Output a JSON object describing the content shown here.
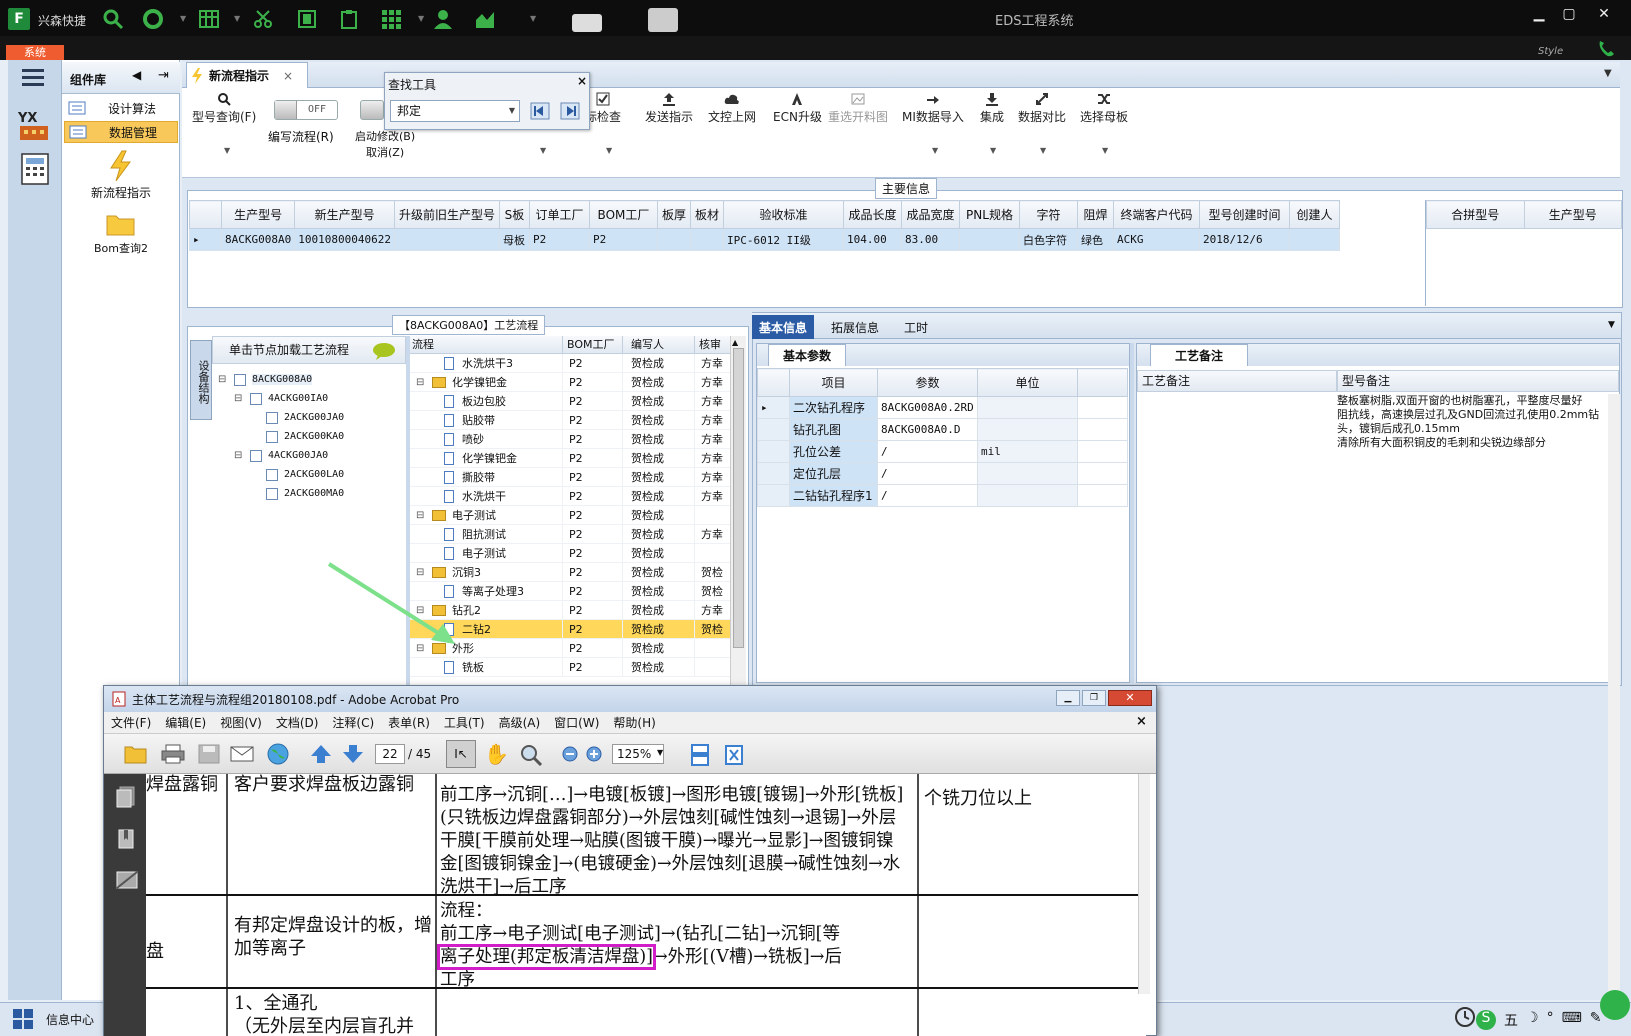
{
  "app": {
    "tag": "兴森快捷",
    "window_title": "EDS工程系统",
    "system_tab": "系统",
    "style_label": "Style"
  },
  "sidebar": {
    "header": "组件库",
    "items": [
      {
        "label": "设计算法"
      },
      {
        "label": "数据管理"
      }
    ],
    "big_items": [
      {
        "label": "新流程指示"
      },
      {
        "label": "Bom查询2"
      }
    ]
  },
  "tabs": [
    {
      "label": "新流程指示"
    }
  ],
  "toolbar": {
    "model_query": "型号查询(F)",
    "edit_flow": "编写流程(R)",
    "toggle_state": "OFF",
    "start_modify": "启动修改(B)",
    "cancel": "取消(Z)",
    "items": [
      {
        "label": "标检查"
      },
      {
        "label": "发送指示"
      },
      {
        "label": "文控上网"
      },
      {
        "label": "ECN升级"
      },
      {
        "label": "重选开料图"
      },
      {
        "label": "MI数据导入"
      },
      {
        "label": "集成"
      },
      {
        "label": "数据对比"
      },
      {
        "label": "选择母板"
      }
    ]
  },
  "find_tool": {
    "title": "查找工具",
    "value": "邦定"
  },
  "main_info": {
    "title": "主要信息",
    "columns": [
      "生产型号",
      "新生产型号",
      "升级前旧生产型号",
      "S板",
      "订单工厂",
      "BOM工厂",
      "板厚",
      "板材",
      "验收标准",
      "成品长度",
      "成品宽度",
      "PNL规格",
      "字符",
      "阻焊",
      "终端客户代码",
      "型号创建时间",
      "创建人"
    ],
    "row": [
      "8ACKG008A0",
      "10010800040622",
      "",
      "母板",
      "P2",
      "P2",
      "",
      "",
      "IPC-6012 II级",
      "104.00",
      "83.00",
      "",
      "白色字符",
      "绿色",
      "ACKG",
      "2018/12/6",
      ""
    ],
    "side_columns": [
      "合拼型号",
      "生产型号"
    ]
  },
  "flow": {
    "title": "【8ACKG008A0】工艺流程",
    "tree_hint": "单击节点加载工艺流程",
    "side_tab": "设备结构",
    "tree": [
      {
        "label": "8ACKG008A0",
        "level": 0
      },
      {
        "label": "4ACKG00IA0",
        "level": 1
      },
      {
        "label": "2ACKG00JA0",
        "level": 2
      },
      {
        "label": "2ACKG00KA0",
        "level": 2
      },
      {
        "label": "4ACKG00JA0",
        "level": 1
      },
      {
        "label": "2ACKG00LA0",
        "level": 2
      },
      {
        "label": "2ACKG00MA0",
        "level": 2
      }
    ],
    "columns": [
      "流程",
      "BOM工厂",
      "编写人",
      "核审"
    ],
    "rows": [
      {
        "name": "水洗烘干3",
        "folder": false,
        "bom": "P2",
        "writer": "贺检成",
        "check": "方幸"
      },
      {
        "name": "化学镍钯金",
        "folder": true,
        "bom": "P2",
        "writer": "贺检成",
        "check": "方幸"
      },
      {
        "name": "板边包胶",
        "folder": false,
        "bom": "P2",
        "writer": "贺检成",
        "check": "方幸"
      },
      {
        "name": "贴胶带",
        "folder": false,
        "bom": "P2",
        "writer": "贺检成",
        "check": "方幸"
      },
      {
        "name": "喷砂",
        "folder": false,
        "bom": "P2",
        "writer": "贺检成",
        "check": "方幸"
      },
      {
        "name": "化学镍钯金",
        "folder": false,
        "bom": "P2",
        "writer": "贺检成",
        "check": "方幸"
      },
      {
        "name": "撕胶带",
        "folder": false,
        "bom": "P2",
        "writer": "贺检成",
        "check": "方幸"
      },
      {
        "name": "水洗烘干",
        "folder": false,
        "bom": "P2",
        "writer": "贺检成",
        "check": "方幸"
      },
      {
        "name": "电子测试",
        "folder": true,
        "bom": "P2",
        "writer": "贺检成",
        "check": ""
      },
      {
        "name": "阻抗测试",
        "folder": false,
        "bom": "P2",
        "writer": "贺检成",
        "check": "方幸"
      },
      {
        "name": "电子测试",
        "folder": false,
        "bom": "P2",
        "writer": "贺检成",
        "check": ""
      },
      {
        "name": "沉铜3",
        "folder": true,
        "bom": "P2",
        "writer": "贺检成",
        "check": "贺检"
      },
      {
        "name": "等离子处理3",
        "folder": false,
        "bom": "P2",
        "writer": "贺检成",
        "check": "贺检"
      },
      {
        "name": "钻孔2",
        "folder": true,
        "bom": "P2",
        "writer": "贺检成",
        "check": "方幸"
      },
      {
        "name": "二钻2",
        "folder": false,
        "bom": "P2",
        "writer": "贺检成",
        "check": "贺检",
        "selected": true
      },
      {
        "name": "外形",
        "folder": true,
        "bom": "P2",
        "writer": "贺检成",
        "check": ""
      },
      {
        "name": "铣板",
        "folder": false,
        "bom": "P2",
        "writer": "贺检成",
        "check": ""
      }
    ]
  },
  "detail": {
    "tabs": [
      "基本信息",
      "拓展信息",
      "工时"
    ],
    "sub_tab": "基本参数",
    "columns": [
      "项目",
      "参数",
      "单位"
    ],
    "rows": [
      {
        "item": "二次钻孔程序",
        "param": "8ACKG008A0.2RD",
        "unit": ""
      },
      {
        "item": "钻孔孔图",
        "param": "8ACKG008A0.D",
        "unit": ""
      },
      {
        "item": "孔位公差",
        "param": "/",
        "unit": "mil"
      },
      {
        "item": "定位孔层",
        "param": "/",
        "unit": ""
      },
      {
        "item": "二钻钻孔程序1",
        "param": "/",
        "unit": ""
      }
    ]
  },
  "remarks": {
    "tab": "工艺备注",
    "col1": "工艺备注",
    "col2": "型号备注",
    "text": [
      "整板塞树脂,双面开窗的也树脂塞孔，平整度尽量好",
      "阻抗线，高速换层过孔及GND回流过孔使用0.2mm钻头，镀铜后成孔0.15mm",
      "清除所有大面积铜皮的毛刺和尖锐边缘部分"
    ]
  },
  "acrobat": {
    "title": "主体工艺流程与流程组20180108.pdf - Adobe Acrobat Pro",
    "menu": [
      "文件(F)",
      "编辑(E)",
      "视图(V)",
      "文档(D)",
      "注释(C)",
      "表单(R)",
      "工具(T)",
      "高级(A)",
      "窗口(W)",
      "帮助(H)"
    ],
    "page": "22",
    "pages": "/ 45",
    "zoom": "125%",
    "doc": {
      "r1c1": "焊盘露铜",
      "r1c2": "客户要求焊盘板边露铜",
      "r1c3": "前工序→沉铜[…]→电镀[板镀]→图形电镀[镀锡]→外形[铣板](只铣板边焊盘露铜部分)→外层蚀刻[碱性蚀刻→退锡]→外层干膜[干膜前处理→贴膜(图镀干膜)→曝光→显影]→图镀铜镍金[图镀铜镍金]→(电镀硬金)→外层蚀刻[退膜→碱性蚀刻→水洗烘干]→后工序",
      "r1c4": "个铣刀位以上",
      "r2c1": "盘",
      "r2c2": "有邦定焊盘设计的板，增加等离子",
      "r2c3a": "流程：",
      "r2c3b": "前工序→电子测试[电子测试]→(钻孔[二钻]→沉铜[等",
      "r2c3hl": "离子处理(邦定板清洁焊盘)]",
      "r2c3c": "→外形[(V槽)→铣板]→后",
      "r2c3d": "工序",
      "r3c2a": "1、全通孔",
      "r3c2b": "（无外层至内层盲孔并"
    }
  },
  "status": {
    "label": "信息中心"
  },
  "colors": {
    "accent": "#ef5c2f",
    "selected": "#ffd75a",
    "highlight": "#d21ec8",
    "arrow": "#7de08a"
  }
}
